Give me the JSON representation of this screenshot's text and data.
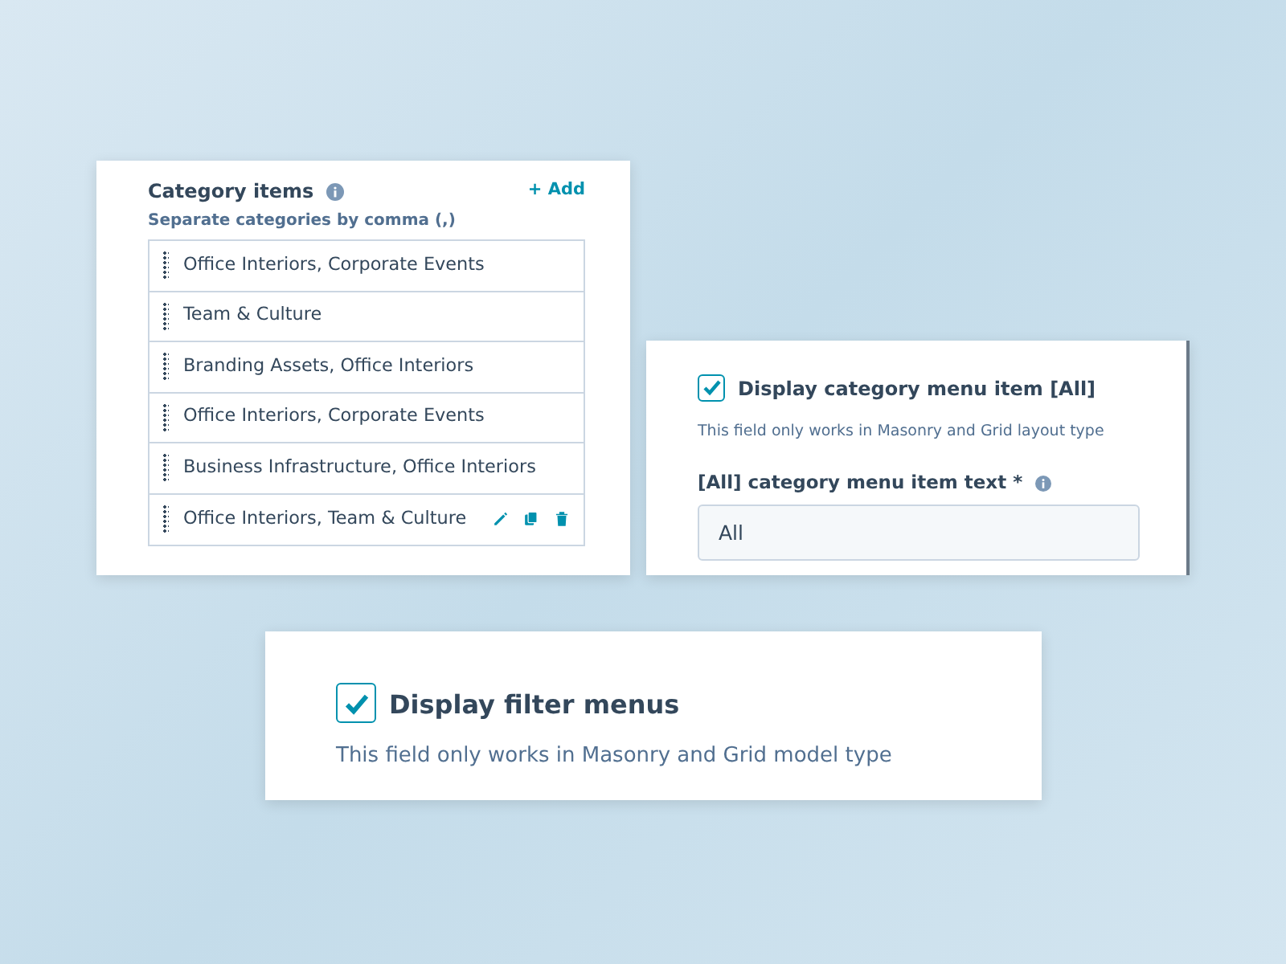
{
  "category_panel": {
    "title": "Category items",
    "add_link": "+ Add",
    "hint": "Separate categories by comma (,)",
    "items": [
      {
        "text": "Office Interiors, Corporate Events",
        "show_actions": false
      },
      {
        "text": "Team & Culture",
        "show_actions": false
      },
      {
        "text": "Branding Assets, Office Interiors",
        "show_actions": false
      },
      {
        "text": "Office Interiors, Corporate Events",
        "show_actions": false
      },
      {
        "text": "Business Infrastructure, Office Interiors",
        "show_actions": false
      },
      {
        "text": "Office Interiors, Team & Culture",
        "show_actions": true
      }
    ]
  },
  "menu_item_panel": {
    "checkbox": {
      "label": "Display category menu item [All]",
      "checked": true
    },
    "help": "This field only works in Masonry and Grid layout type",
    "field_label": "[All] category menu item text *",
    "field_value": "All"
  },
  "filter_panel": {
    "checkbox": {
      "label": "Display filter menus",
      "checked": true
    },
    "help": "This field only works in Masonry and Grid model type"
  }
}
